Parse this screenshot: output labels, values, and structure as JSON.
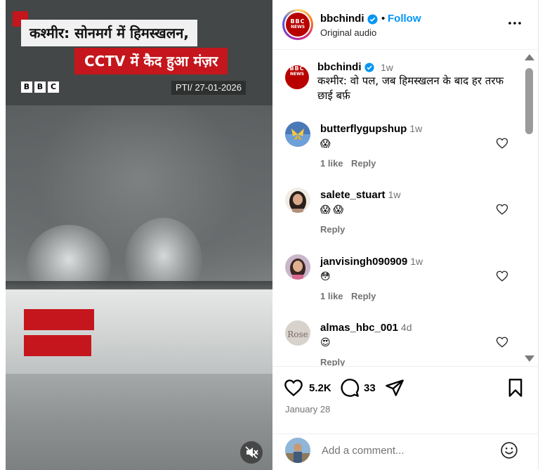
{
  "video": {
    "headline_line1": "कश्मीर: सोनमर्ग में हिमस्खलन,",
    "headline_line2": "CCTV में कैद हुआ मंज़र",
    "logo_letters": [
      "B",
      "B",
      "C"
    ],
    "source_stamp": "PTI/ 27-01-2026",
    "mute_icon": "volume-muted-icon",
    "brand_red": "#c4161c"
  },
  "header": {
    "username": "bbchindi",
    "follow_label": "Follow",
    "dot": "•",
    "subtitle": "Original audio",
    "more_icon": "more-horizontal-icon",
    "avatar_text_top": "BBC",
    "avatar_text_bottom": "NEWS",
    "follow_color": "#0095f6"
  },
  "caption": {
    "username": "bbchindi",
    "time": "1w",
    "text": "कश्मीर:  वो पल, जब हिमस्खलन के बाद हर तरफ छाई बर्फ़"
  },
  "comments": [
    {
      "username": "butterflygupshup",
      "time": "1w",
      "emoji": "😱",
      "likes": "1 like",
      "reply": "Reply"
    },
    {
      "username": "salete_stuart",
      "time": "1w",
      "emoji": "😱 😱",
      "likes": "",
      "reply": "Reply"
    },
    {
      "username": "janvisingh090909",
      "time": "1w",
      "emoji": "😳",
      "likes": "1 like",
      "reply": "Reply"
    },
    {
      "username": "almas_hbc_001",
      "time": "4d",
      "emoji": "😍",
      "likes": "",
      "reply": "Reply",
      "avatar_text": "Rose"
    }
  ],
  "actions": {
    "like_count": "5.2K",
    "comment_count": "33",
    "date": "January 28",
    "icons": [
      "heart-icon",
      "comment-icon",
      "share-icon",
      "bookmark-icon"
    ]
  },
  "add_comment": {
    "placeholder": "Add a comment...",
    "emoji_icon": "smiley-icon"
  }
}
